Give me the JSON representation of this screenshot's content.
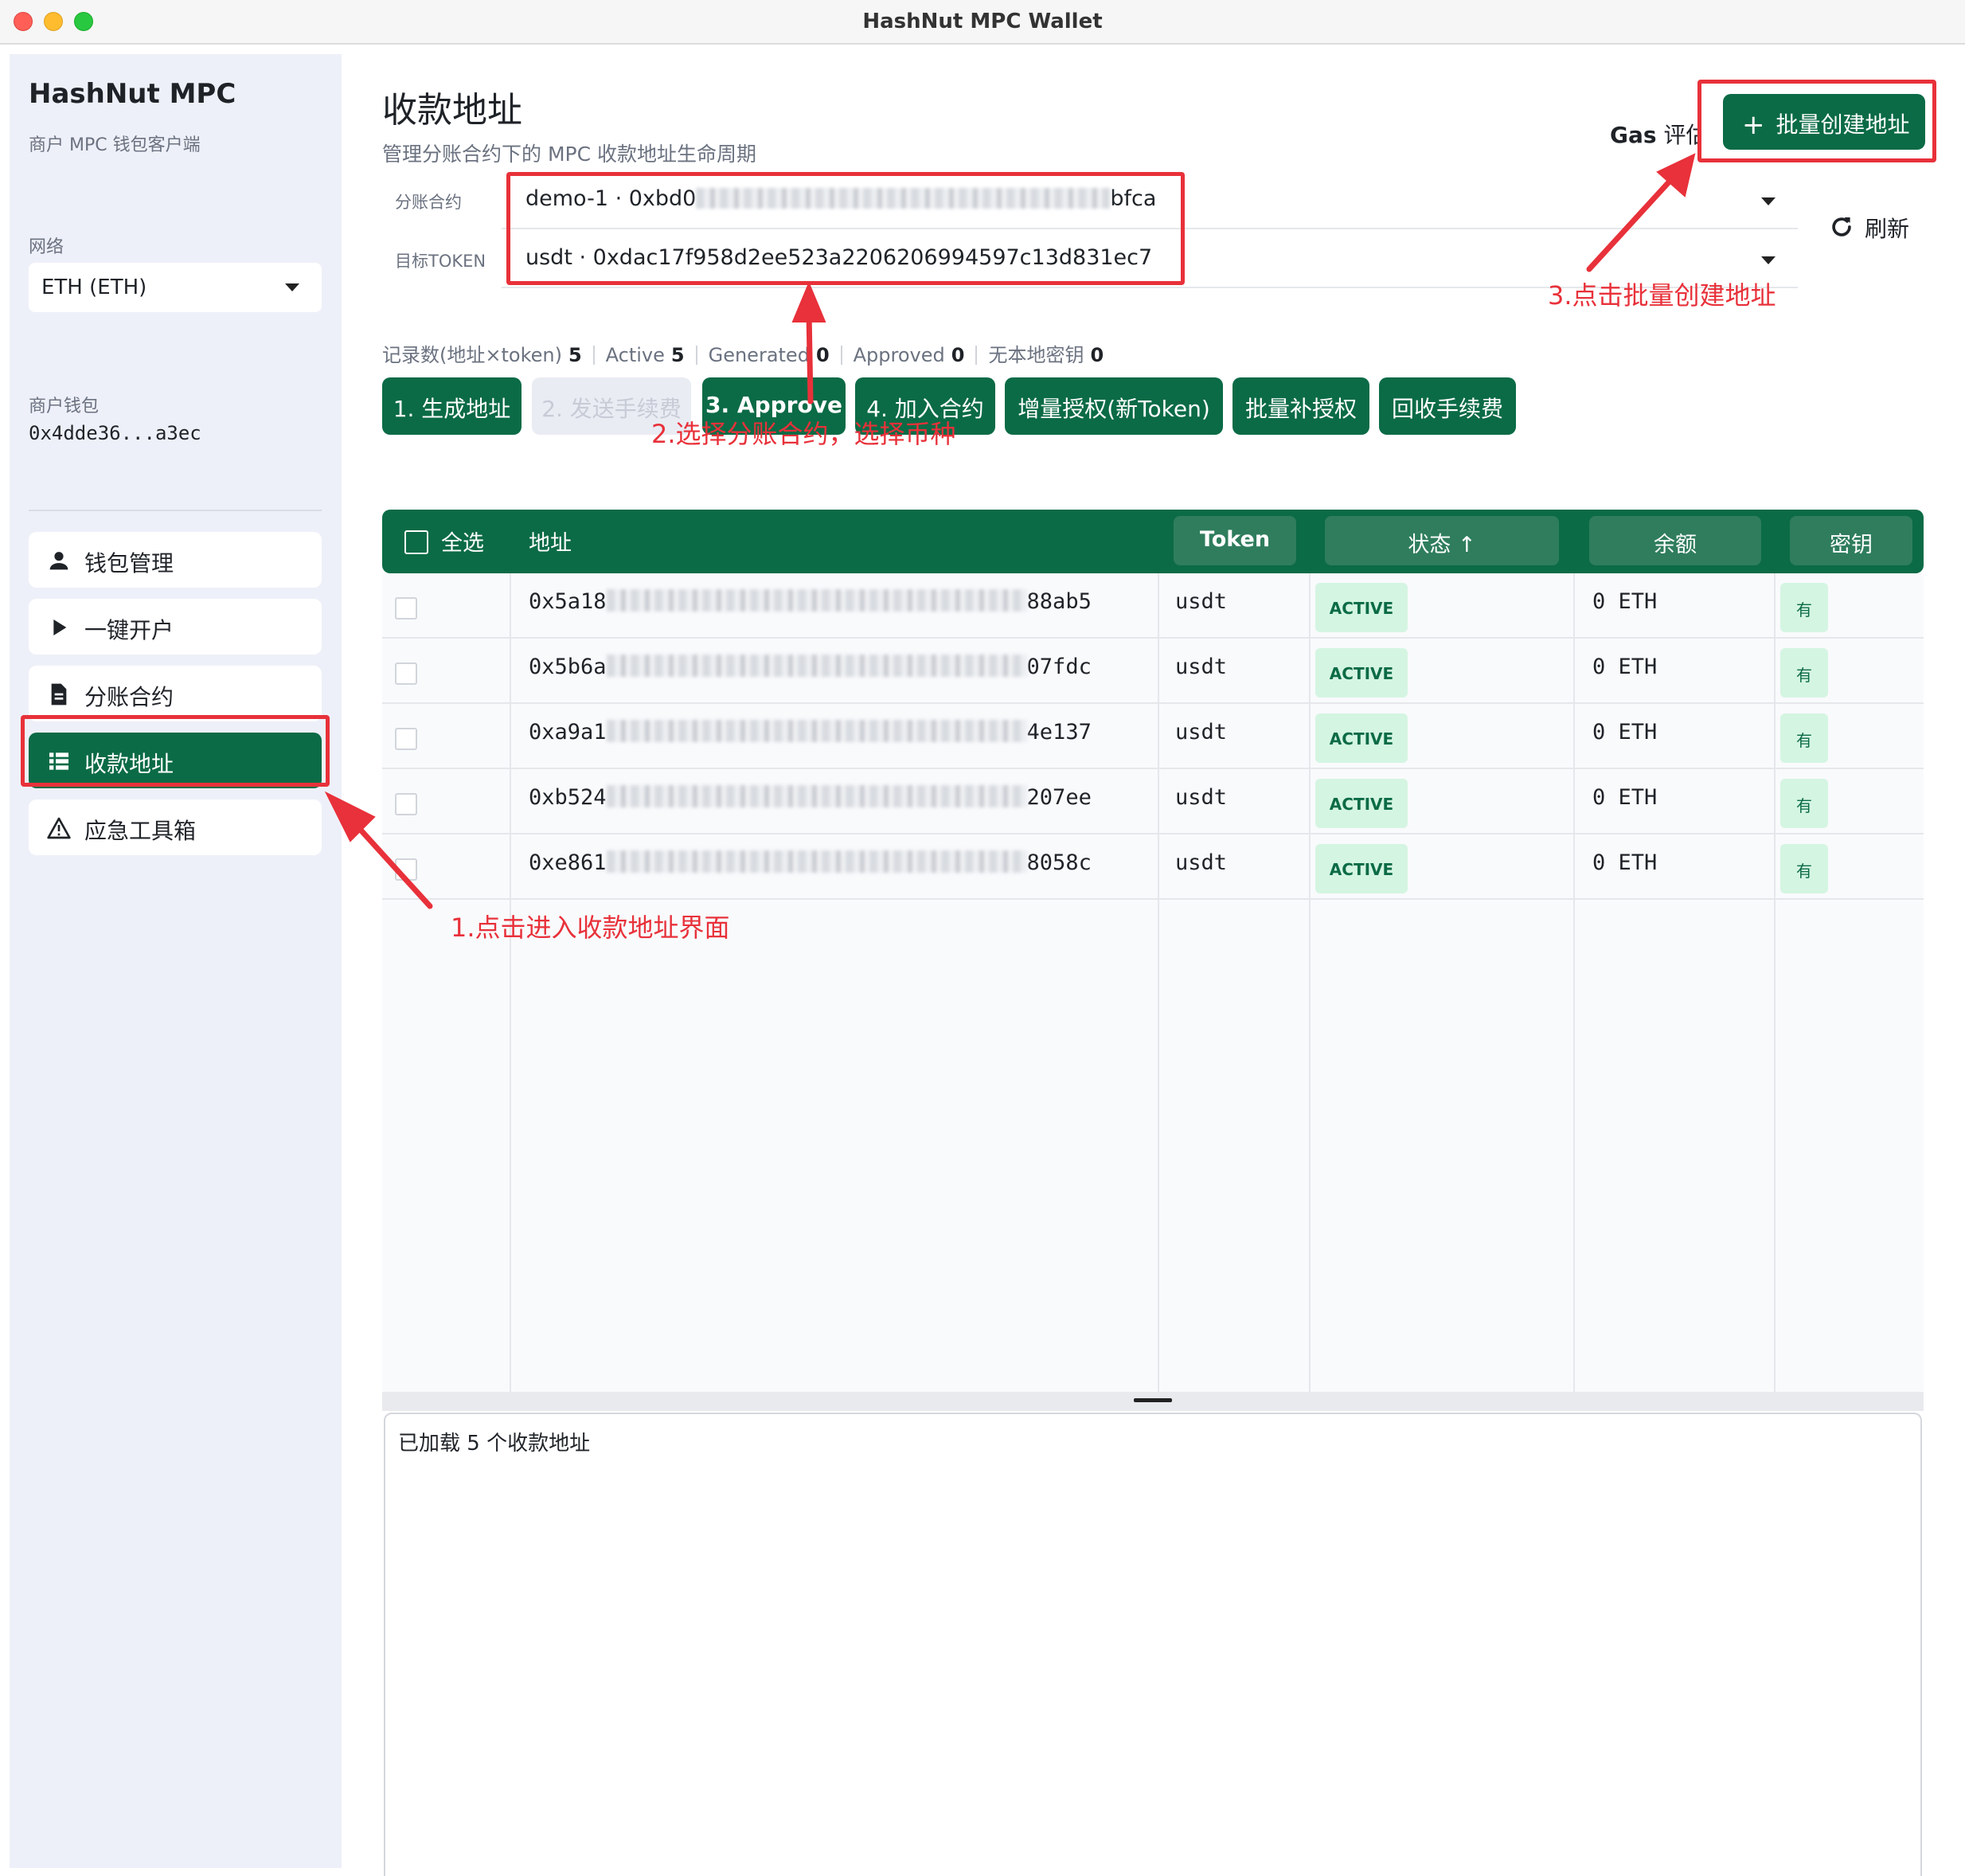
{
  "window": {
    "title": "HashNut MPC Wallet"
  },
  "sidebar": {
    "brand_title": "HashNut MPC",
    "brand_subtitle": "商户 MPC 钱包客户端",
    "network_label": "网络",
    "network_value": "ETH (ETH)",
    "wallet_label": "商户钱包",
    "wallet_address": "0x4dde36...a3ec",
    "items": [
      {
        "label": "钱包管理",
        "icon": "person-icon"
      },
      {
        "label": "一键开户",
        "icon": "play-icon"
      },
      {
        "label": "分账合约",
        "icon": "document-icon"
      },
      {
        "label": "收款地址",
        "icon": "list-icon",
        "active": true
      },
      {
        "label": "应急工具箱",
        "icon": "warning-icon"
      }
    ]
  },
  "header": {
    "title": "收款地址",
    "subtitle": "管理分账合约下的 MPC 收款地址生命周期",
    "gas_bold": "Gas",
    "gas_rest": " 评估",
    "batch_create_label": "批量创建地址",
    "refresh_label": "刷新"
  },
  "filters": {
    "contract_label": "分账合约",
    "contract_value_prefix": "demo-1 · 0xbd0",
    "contract_value_suffix": "bfca",
    "token_label": "目标TOKEN",
    "token_value": "usdt · 0xdac17f958d2ee523a2206206994597c13d831ec7"
  },
  "stats": [
    {
      "label": "记录数(地址×token)",
      "value": "5"
    },
    {
      "label": "Active",
      "value": "5"
    },
    {
      "label": "Generated",
      "value": "0"
    },
    {
      "label": "Approved",
      "value": "0"
    },
    {
      "label": "无本地密钥",
      "value": "0"
    }
  ],
  "actions": [
    {
      "label": "1. 生成地址",
      "enabled": true
    },
    {
      "label": "2. 发送手续费",
      "enabled": false
    },
    {
      "label": "3. Approve",
      "enabled": true
    },
    {
      "label": "4. 加入合约",
      "enabled": true
    },
    {
      "label": "增量授权(新Token)",
      "enabled": true
    },
    {
      "label": "批量补授权",
      "enabled": true
    },
    {
      "label": "回收手续费",
      "enabled": true
    }
  ],
  "table": {
    "headers": {
      "select_all": "全选",
      "address": "地址",
      "token": "Token",
      "status": "状态 ↑",
      "balance": "余额",
      "key": "密钥"
    },
    "rows": [
      {
        "addr_prefix": "0x5a18",
        "addr_suffix": "88ab5",
        "token": "usdt",
        "status": "ACTIVE",
        "balance": "0 ETH",
        "key": "有"
      },
      {
        "addr_prefix": "0x5b6a",
        "addr_suffix": "07fdc",
        "token": "usdt",
        "status": "ACTIVE",
        "balance": "0 ETH",
        "key": "有"
      },
      {
        "addr_prefix": "0xa9a1",
        "addr_suffix": "4e137",
        "token": "usdt",
        "status": "ACTIVE",
        "balance": "0 ETH",
        "key": "有"
      },
      {
        "addr_prefix": "0xb524",
        "addr_suffix": "207ee",
        "token": "usdt",
        "status": "ACTIVE",
        "balance": "0 ETH",
        "key": "有"
      },
      {
        "addr_prefix": "0xe861",
        "addr_suffix": "8058c",
        "token": "usdt",
        "status": "ACTIVE",
        "balance": "0 ETH",
        "key": "有"
      }
    ]
  },
  "log": {
    "text": "已加载 5  个收款地址"
  },
  "annotations": {
    "step1": "1.点击进入收款地址界面",
    "step2": "2.选择分账合约，选择币种",
    "step3": "3.点击批量创建地址"
  },
  "colors": {
    "primary": "#0b6b46",
    "sidebar_bg": "#eef0f9",
    "status_bg": "#d4f5e2",
    "annotation": "#e8313a"
  }
}
